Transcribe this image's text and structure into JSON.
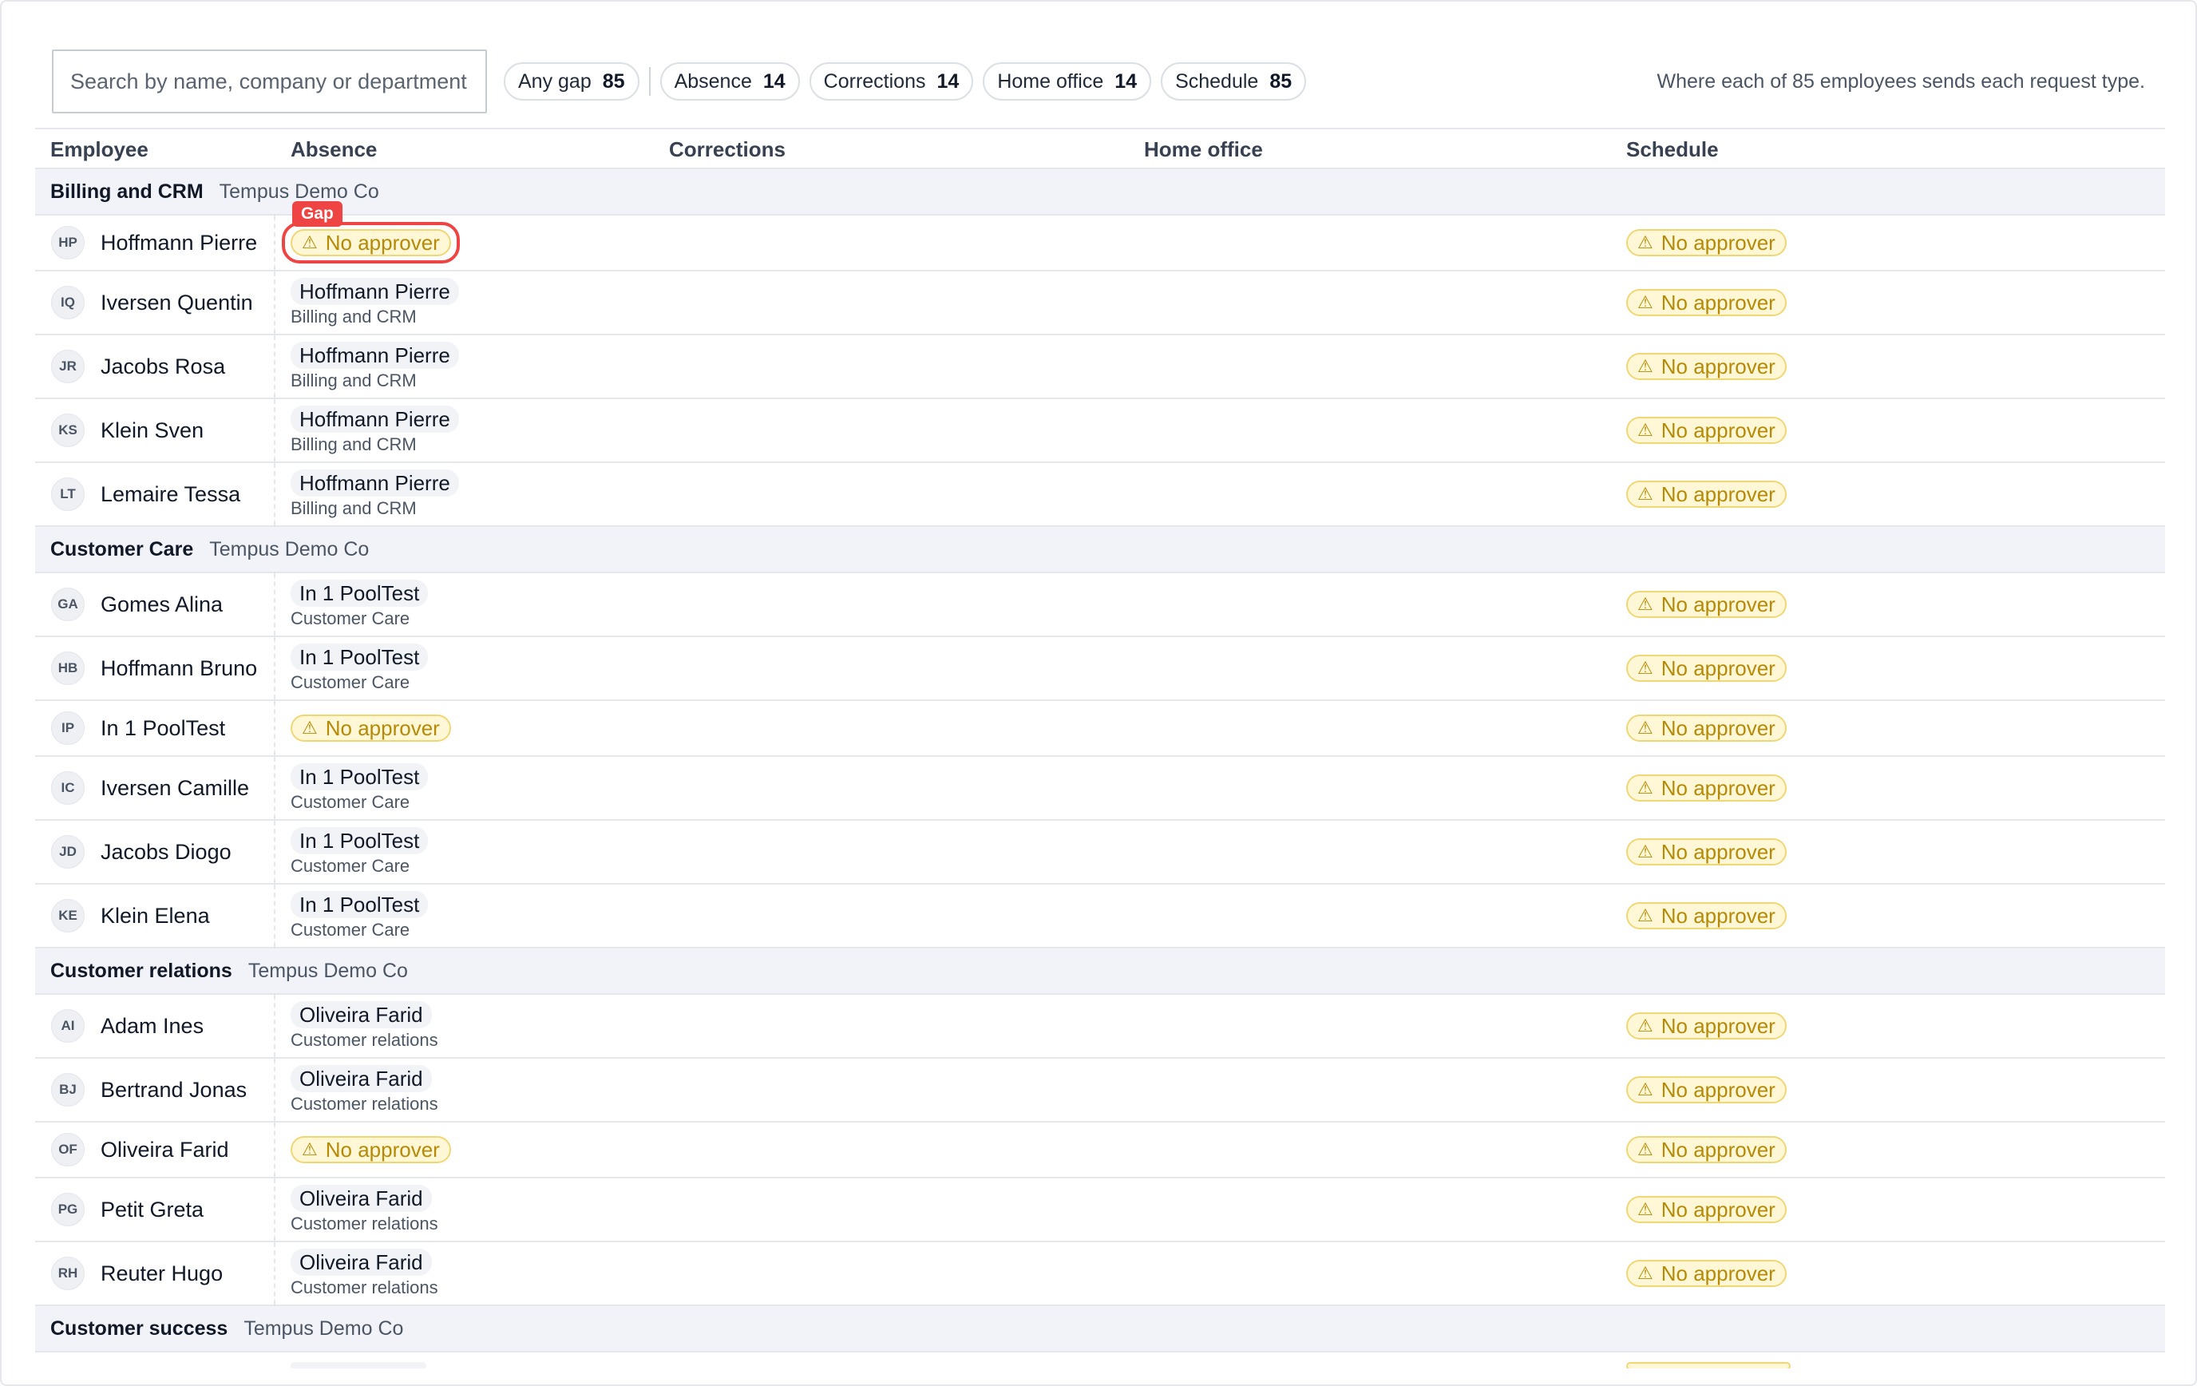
{
  "search": {
    "placeholder": "Search by name, company or department"
  },
  "filters": [
    {
      "label": "Any gap",
      "count": "85"
    },
    {
      "label": "Absence",
      "count": "14"
    },
    {
      "label": "Corrections",
      "count": "14"
    },
    {
      "label": "Home office",
      "count": "14"
    },
    {
      "label": "Schedule",
      "count": "85"
    }
  ],
  "summary": "Where each of 85 employees sends each request type.",
  "columns": {
    "employee": "Employee",
    "absence": "Absence",
    "corrections": "Corrections",
    "home_office": "Home office",
    "schedule": "Schedule"
  },
  "labels": {
    "no_approver": "No approver",
    "gap": "Gap"
  },
  "groups": [
    {
      "name": "Billing and CRM",
      "company": "Tempus Demo Co",
      "rows": [
        {
          "initials": "HP",
          "name": "Hoffmann Pierre",
          "absence": null,
          "gap": true,
          "schedule": null
        },
        {
          "initials": "IQ",
          "name": "Iversen Quentin",
          "absence": {
            "name": "Hoffmann Pierre",
            "dept": "Billing and CRM"
          },
          "schedule": null
        },
        {
          "initials": "JR",
          "name": "Jacobs Rosa",
          "absence": {
            "name": "Hoffmann Pierre",
            "dept": "Billing and CRM"
          },
          "schedule": null
        },
        {
          "initials": "KS",
          "name": "Klein Sven",
          "absence": {
            "name": "Hoffmann Pierre",
            "dept": "Billing and CRM"
          },
          "schedule": null
        },
        {
          "initials": "LT",
          "name": "Lemaire Tessa",
          "absence": {
            "name": "Hoffmann Pierre",
            "dept": "Billing and CRM"
          },
          "schedule": null
        }
      ]
    },
    {
      "name": "Customer Care",
      "company": "Tempus Demo Co",
      "rows": [
        {
          "initials": "GA",
          "name": "Gomes Alina",
          "absence": {
            "name": "In 1 PoolTest",
            "dept": "Customer Care"
          },
          "schedule": null
        },
        {
          "initials": "HB",
          "name": "Hoffmann Bruno",
          "absence": {
            "name": "In 1 PoolTest",
            "dept": "Customer Care"
          },
          "schedule": null
        },
        {
          "initials": "IP",
          "name": "In 1 PoolTest",
          "absence": null,
          "schedule": null
        },
        {
          "initials": "IC",
          "name": "Iversen Camille",
          "absence": {
            "name": "In 1 PoolTest",
            "dept": "Customer Care"
          },
          "schedule": null
        },
        {
          "initials": "JD",
          "name": "Jacobs Diogo",
          "absence": {
            "name": "In 1 PoolTest",
            "dept": "Customer Care"
          },
          "schedule": null
        },
        {
          "initials": "KE",
          "name": "Klein Elena",
          "absence": {
            "name": "In 1 PoolTest",
            "dept": "Customer Care"
          },
          "schedule": null
        }
      ]
    },
    {
      "name": "Customer relations",
      "company": "Tempus Demo Co",
      "rows": [
        {
          "initials": "AI",
          "name": "Adam Ines",
          "absence": {
            "name": "Oliveira Farid",
            "dept": "Customer relations"
          },
          "schedule": null
        },
        {
          "initials": "BJ",
          "name": "Bertrand Jonas",
          "absence": {
            "name": "Oliveira Farid",
            "dept": "Customer relations"
          },
          "schedule": null
        },
        {
          "initials": "OF",
          "name": "Oliveira Farid",
          "absence": null,
          "schedule": null
        },
        {
          "initials": "PG",
          "name": "Petit Greta",
          "absence": {
            "name": "Oliveira Farid",
            "dept": "Customer relations"
          },
          "schedule": null
        },
        {
          "initials": "RH",
          "name": "Reuter Hugo",
          "absence": {
            "name": "Oliveira Farid",
            "dept": "Customer relations"
          },
          "schedule": null
        }
      ]
    },
    {
      "name": "Customer success",
      "company": "Tempus Demo Co",
      "rows": []
    }
  ]
}
